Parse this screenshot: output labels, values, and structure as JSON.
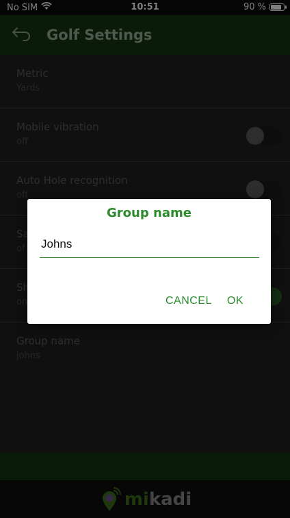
{
  "status_bar": {
    "carrier": "No SIM",
    "time": "10:51",
    "battery": "90 %",
    "battery_level": 0.9,
    "wifi_icon": "wifi-icon",
    "battery_icon": "battery-icon"
  },
  "header": {
    "title": "Golf Settings",
    "back_icon": "back-arrow-icon",
    "color": "#143613"
  },
  "settings": [
    {
      "label": "Metric",
      "value": "Yards",
      "has_toggle": false
    },
    {
      "label": "Mobile vibration",
      "value": "off",
      "has_toggle": true,
      "toggle_on": false
    },
    {
      "label": "Auto Hole recognition",
      "value": "off",
      "has_toggle": true,
      "toggle_on": false
    },
    {
      "label": "Sa",
      "value": "of",
      "has_toggle": true,
      "toggle_on": false
    },
    {
      "label": "Sh",
      "value": "on",
      "has_toggle": true,
      "toggle_on": true
    },
    {
      "label": "Group name",
      "value": "johns",
      "has_toggle": false
    }
  ],
  "dialog": {
    "title": "Group name",
    "input_value": "Johns",
    "cancel_label": "CANCEL",
    "ok_label": "OK",
    "accent": "#2b8a2b"
  },
  "footer": {
    "logo_mi": "mi",
    "logo_kadi": "kadi",
    "logo_icon": "location-pin-icon"
  }
}
